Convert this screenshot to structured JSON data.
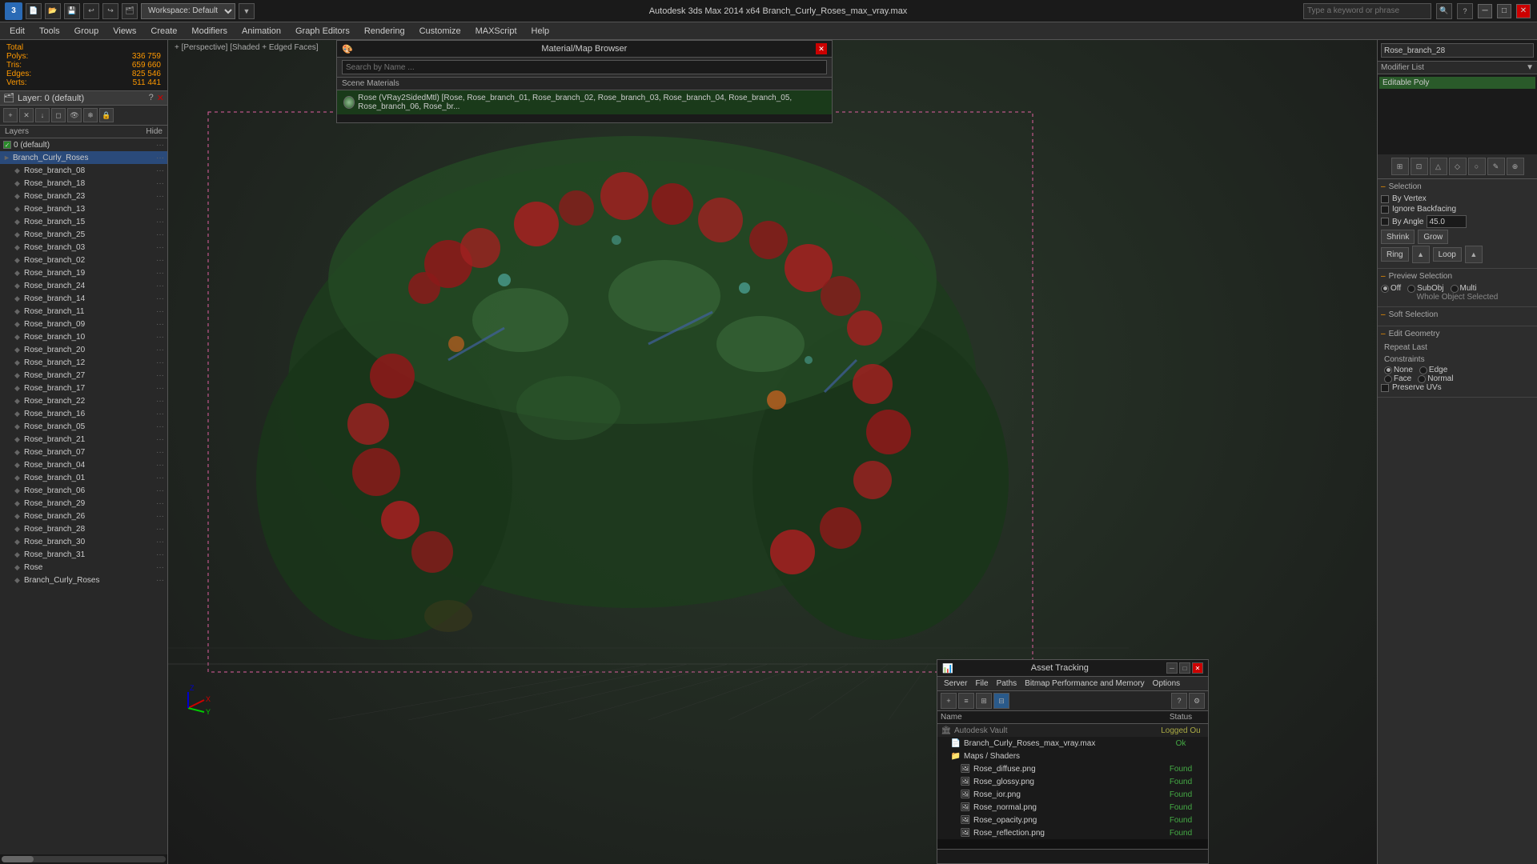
{
  "titlebar": {
    "app_title": "Autodesk 3ds Max 2014 x64",
    "file_name": "Branch_Curly_Roses_max_vray.max",
    "full_title": "Autodesk 3ds Max 2014 x64    Branch_Curly_Roses_max_vray.max",
    "workspace_label": "Workspace: Default",
    "search_placeholder": "Type a keyword or phrase",
    "min_label": "─",
    "max_label": "□",
    "close_label": "✕",
    "logo": "3"
  },
  "menubar": {
    "items": [
      "Edit",
      "Tools",
      "Group",
      "Views",
      "Create",
      "Modifiers",
      "Animation",
      "Graph Editors",
      "Rendering",
      "Customize",
      "MAXScript",
      "Help"
    ]
  },
  "stats": {
    "total_label": "Total",
    "polys_label": "Polys:",
    "polys_val": "336 759",
    "tris_label": "Tris:",
    "tris_val": "659 660",
    "edges_label": "Edges:",
    "edges_val": "825 546",
    "verts_label": "Verts:",
    "verts_val": "511 441"
  },
  "layers_panel": {
    "title": "Layer: 0 (default)",
    "help_label": "?",
    "close_label": "✕",
    "col_layers": "Layers",
    "col_hide": "Hide",
    "items": [
      {
        "name": "0 (default)",
        "level": 0,
        "checked": true,
        "selected": false
      },
      {
        "name": "Branch_Curly_Roses",
        "level": 0,
        "checked": false,
        "selected": true
      },
      {
        "name": "Rose_branch_08",
        "level": 1,
        "checked": false,
        "selected": false
      },
      {
        "name": "Rose_branch_18",
        "level": 1,
        "checked": false,
        "selected": false
      },
      {
        "name": "Rose_branch_23",
        "level": 1,
        "checked": false,
        "selected": false
      },
      {
        "name": "Rose_branch_13",
        "level": 1,
        "checked": false,
        "selected": false
      },
      {
        "name": "Rose_branch_15",
        "level": 1,
        "checked": false,
        "selected": false
      },
      {
        "name": "Rose_branch_25",
        "level": 1,
        "checked": false,
        "selected": false
      },
      {
        "name": "Rose_branch_03",
        "level": 1,
        "checked": false,
        "selected": false
      },
      {
        "name": "Rose_branch_02",
        "level": 1,
        "checked": false,
        "selected": false
      },
      {
        "name": "Rose_branch_19",
        "level": 1,
        "checked": false,
        "selected": false
      },
      {
        "name": "Rose_branch_24",
        "level": 1,
        "checked": false,
        "selected": false
      },
      {
        "name": "Rose_branch_14",
        "level": 1,
        "checked": false,
        "selected": false
      },
      {
        "name": "Rose_branch_11",
        "level": 1,
        "checked": false,
        "selected": false
      },
      {
        "name": "Rose_branch_09",
        "level": 1,
        "checked": false,
        "selected": false
      },
      {
        "name": "Rose_branch_10",
        "level": 1,
        "checked": false,
        "selected": false
      },
      {
        "name": "Rose_branch_20",
        "level": 1,
        "checked": false,
        "selected": false
      },
      {
        "name": "Rose_branch_12",
        "level": 1,
        "checked": false,
        "selected": false
      },
      {
        "name": "Rose_branch_27",
        "level": 1,
        "checked": false,
        "selected": false
      },
      {
        "name": "Rose_branch_17",
        "level": 1,
        "checked": false,
        "selected": false
      },
      {
        "name": "Rose_branch_22",
        "level": 1,
        "checked": false,
        "selected": false
      },
      {
        "name": "Rose_branch_16",
        "level": 1,
        "checked": false,
        "selected": false
      },
      {
        "name": "Rose_branch_05",
        "level": 1,
        "checked": false,
        "selected": false
      },
      {
        "name": "Rose_branch_21",
        "level": 1,
        "checked": false,
        "selected": false
      },
      {
        "name": "Rose_branch_07",
        "level": 1,
        "checked": false,
        "selected": false
      },
      {
        "name": "Rose_branch_04",
        "level": 1,
        "checked": false,
        "selected": false
      },
      {
        "name": "Rose_branch_01",
        "level": 1,
        "checked": false,
        "selected": false
      },
      {
        "name": "Rose_branch_06",
        "level": 1,
        "checked": false,
        "selected": false
      },
      {
        "name": "Rose_branch_29",
        "level": 1,
        "checked": false,
        "selected": false
      },
      {
        "name": "Rose_branch_26",
        "level": 1,
        "checked": false,
        "selected": false
      },
      {
        "name": "Rose_branch_28",
        "level": 1,
        "checked": false,
        "selected": false
      },
      {
        "name": "Rose_branch_30",
        "level": 1,
        "checked": false,
        "selected": false
      },
      {
        "name": "Rose_branch_31",
        "level": 1,
        "checked": false,
        "selected": false
      },
      {
        "name": "Rose",
        "level": 1,
        "checked": false,
        "selected": false
      },
      {
        "name": "Branch_Curly_Roses",
        "level": 1,
        "checked": false,
        "selected": false
      }
    ]
  },
  "viewport": {
    "label": "+ [Perspective] [Shaded + Edged Faces]"
  },
  "right_panel": {
    "obj_name": "Rose_branch_28",
    "modifier_list_label": "Modifier List",
    "modifier_list_arrow": "▼",
    "modifier": "Editable Poly",
    "selection_title": "Selection",
    "by_vertex_label": "By Vertex",
    "ignore_backfacing_label": "Ignore Backfacing",
    "by_angle_label": "By Angle",
    "by_angle_val": "45.0",
    "shrink_label": "Shrink",
    "grow_label": "Grow",
    "ring_label": "Ring",
    "loop_label": "Loop",
    "preview_selection_title": "Preview Selection",
    "radio_off": "Off",
    "radio_subobj": "SubObj",
    "radio_multi": "Multi",
    "whole_object_label": "Whole Object Selected",
    "soft_selection_title": "Soft Selection",
    "edit_geometry_title": "Edit Geometry",
    "repeat_last_label": "Repeat Last",
    "constraints_label": "Constraints",
    "none_label": "None",
    "edge_label": "Edge",
    "face_label": "Face",
    "normal_label": "Normal",
    "preserve_uvs_label": "Preserve UVs"
  },
  "mat_browser": {
    "title": "Material/Map Browser",
    "close_label": "✕",
    "search_placeholder": "Search by Name ...",
    "scene_materials_label": "Scene Materials",
    "mat_item": "Rose (VRay2SidedMtl) [Rose, Rose_branch_01, Rose_branch_02, Rose_branch_03, Rose_branch_04, Rose_branch_05, Rose_branch_06, Rose_br..."
  },
  "asset_tracking": {
    "title": "Asset Tracking",
    "min_label": "─",
    "max_label": "□",
    "close_label": "✕",
    "menu_items": [
      "Server",
      "File",
      "Paths",
      "Bitmap Performance and Memory",
      "Options"
    ],
    "col_name": "Name",
    "col_status": "Status",
    "items": [
      {
        "name": "Autodesk Vault",
        "level": 0,
        "type": "vault",
        "status": "Logged Ou",
        "status_class": "status-loggedout"
      },
      {
        "name": "Branch_Curly_Roses_max_vray.max",
        "level": 1,
        "type": "file",
        "status": "Ok",
        "status_class": "status-ok"
      },
      {
        "name": "Maps / Shaders",
        "level": 1,
        "type": "folder",
        "status": "",
        "status_class": ""
      },
      {
        "name": "Rose_diffuse.png",
        "level": 2,
        "type": "image",
        "status": "Found",
        "status_class": "status-found"
      },
      {
        "name": "Rose_glossy.png",
        "level": 2,
        "type": "image",
        "status": "Found",
        "status_class": "status-found"
      },
      {
        "name": "Rose_ior.png",
        "level": 2,
        "type": "image",
        "status": "Found",
        "status_class": "status-found"
      },
      {
        "name": "Rose_normal.png",
        "level": 2,
        "type": "image",
        "status": "Found",
        "status_class": "status-found"
      },
      {
        "name": "Rose_opacity.png",
        "level": 2,
        "type": "image",
        "status": "Found",
        "status_class": "status-found"
      },
      {
        "name": "Rose_reflection.png",
        "level": 2,
        "type": "image",
        "status": "Found",
        "status_class": "status-found"
      }
    ]
  }
}
